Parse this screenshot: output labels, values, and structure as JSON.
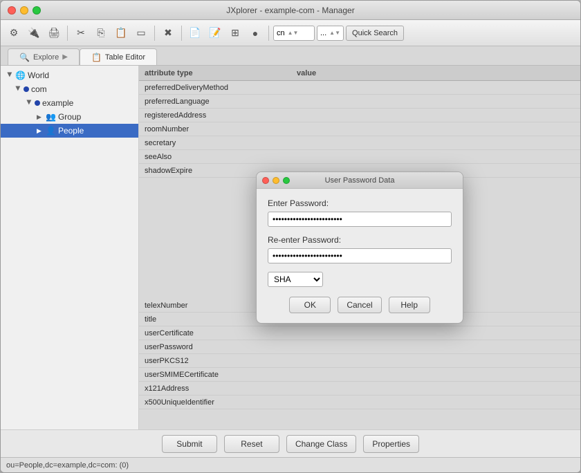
{
  "window": {
    "title": "JXplorer - example-com - Manager",
    "traffic_lights": [
      "red",
      "yellow",
      "green"
    ]
  },
  "toolbar": {
    "items": [
      {
        "name": "settings-icon",
        "icon": "⚙"
      },
      {
        "name": "connect-icon",
        "icon": "🔌"
      },
      {
        "name": "print-icon",
        "icon": "🖨"
      },
      {
        "name": "cut-icon",
        "icon": "✂"
      },
      {
        "name": "copy-icon",
        "icon": "📋"
      },
      {
        "name": "paste-icon",
        "icon": "📄"
      },
      {
        "name": "delete-icon",
        "icon": "🗑"
      },
      {
        "name": "stop-icon",
        "icon": "✖"
      },
      {
        "name": "new-icon",
        "icon": "📄"
      },
      {
        "name": "edit-icon",
        "icon": "📝"
      },
      {
        "name": "grid-icon",
        "icon": "⊞"
      },
      {
        "name": "circle-icon",
        "icon": "●"
      }
    ],
    "combo_value": "cn",
    "combo_dots": "...",
    "quick_search_label": "Quick Search"
  },
  "tabs": [
    {
      "name": "explore-tab",
      "label": "Explore",
      "icon": "🔍",
      "active": false
    },
    {
      "name": "table-editor-tab",
      "label": "Table Editor",
      "icon": "📋",
      "active": true
    }
  ],
  "tree": {
    "items": [
      {
        "id": "world",
        "label": "World",
        "indent": 0,
        "icon": "🌐",
        "expanded": true
      },
      {
        "id": "com",
        "label": "com",
        "indent": 1,
        "icon": "dot",
        "expanded": true
      },
      {
        "id": "example",
        "label": "example",
        "indent": 2,
        "icon": "dot",
        "expanded": true
      },
      {
        "id": "group",
        "label": "Group",
        "indent": 3,
        "icon": "👥",
        "expanded": false
      },
      {
        "id": "people",
        "label": "People",
        "indent": 3,
        "icon": "👤",
        "selected": true
      }
    ]
  },
  "table": {
    "headers": [
      {
        "name": "attr-header",
        "label": "attribute type"
      },
      {
        "name": "val-header",
        "label": "value"
      }
    ],
    "rows_before": [
      {
        "attr": "preferredDeliveryMethod",
        "val": ""
      },
      {
        "attr": "preferredLanguage",
        "val": ""
      },
      {
        "attr": "registeredAddress",
        "val": ""
      },
      {
        "attr": "roomNumber",
        "val": ""
      },
      {
        "attr": "secretary",
        "val": ""
      },
      {
        "attr": "seeAlso",
        "val": ""
      },
      {
        "attr": "shadowExpire",
        "val": ""
      }
    ],
    "rows_after": [
      {
        "attr": "telexNumber",
        "val": ""
      },
      {
        "attr": "title",
        "val": ""
      },
      {
        "attr": "userCertificate",
        "val": ""
      },
      {
        "attr": "userPassword",
        "val": ""
      },
      {
        "attr": "userPKCS12",
        "val": ""
      },
      {
        "attr": "userSMIMECertificate",
        "val": ""
      },
      {
        "attr": "x121Address",
        "val": ""
      },
      {
        "attr": "x500UniqueIdentifier",
        "val": ""
      }
    ]
  },
  "modal": {
    "title": "User Password Data",
    "enter_password_label": "Enter Password:",
    "enter_password_value": "••••••••••••••••••••••••",
    "reenter_password_label": "Re-enter Password:",
    "reenter_password_value": "••••••••••••••••••••••••",
    "algorithm_value": "SHA",
    "buttons": [
      {
        "name": "ok-button",
        "label": "OK"
      },
      {
        "name": "cancel-button",
        "label": "Cancel"
      },
      {
        "name": "help-button",
        "label": "Help"
      }
    ]
  },
  "bottom_buttons": [
    {
      "name": "submit-button",
      "label": "Submit"
    },
    {
      "name": "reset-button",
      "label": "Reset"
    },
    {
      "name": "change-class-button",
      "label": "Change Class"
    },
    {
      "name": "properties-button",
      "label": "Properties"
    }
  ],
  "status_bar": {
    "text": "ou=People,dc=example,dc=com: (0)"
  }
}
